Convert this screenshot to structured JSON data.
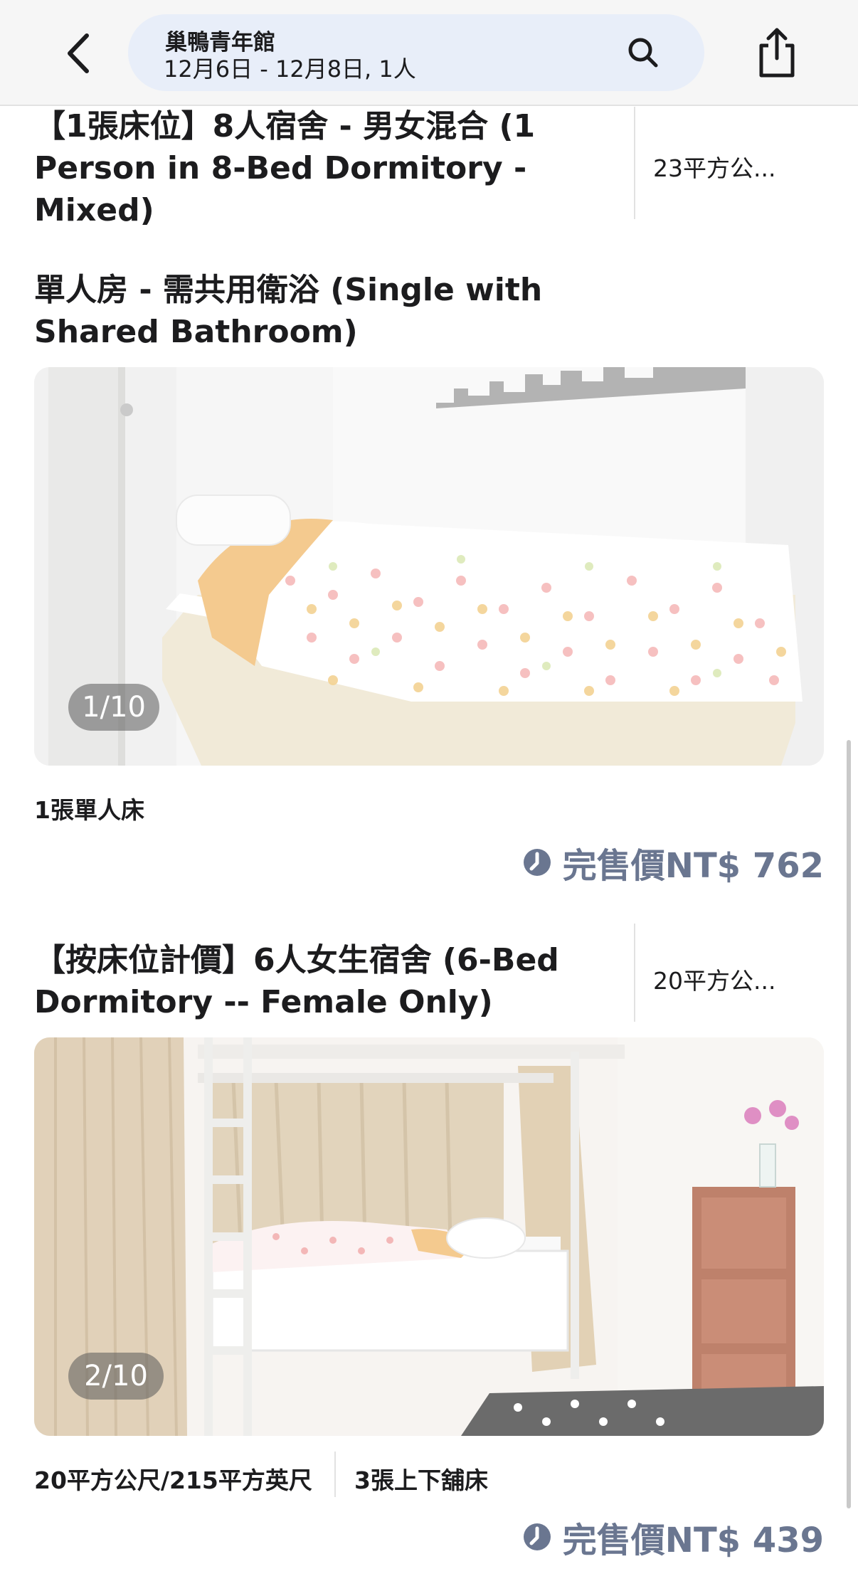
{
  "header": {
    "hostel_name": "巢鴨青年館",
    "search_summary": "12月6日 - 12月8日, 1人"
  },
  "rooms": [
    {
      "title": "【1張床位】8人宿舍 - 男女混合 (1 Person in 8-Bed Dormitory - Mixed)",
      "size_short": "23平方公..."
    },
    {
      "title": "單人房 - 需共用衛浴 (Single with Shared Bathroom)",
      "photo_counter": "1/10",
      "features": [
        "1張單人床"
      ],
      "price": "完售價NT$ 762"
    },
    {
      "title": "【按床位計價】6人女生宿舍 (6-Bed Dormitory -- Female Only)",
      "size_short": "20平方公...",
      "photo_counter": "2/10",
      "features": [
        "20平方公尺/215平方英尺",
        "3張上下舖床"
      ],
      "price": "完售價NT$ 439"
    }
  ],
  "colors": {
    "price_text": "#6a7690",
    "search_pill": "#e8eef9",
    "topbar": "#f6f6f6"
  },
  "icons": [
    "back-chevron-icon",
    "search-icon",
    "share-icon",
    "clock-icon"
  ]
}
